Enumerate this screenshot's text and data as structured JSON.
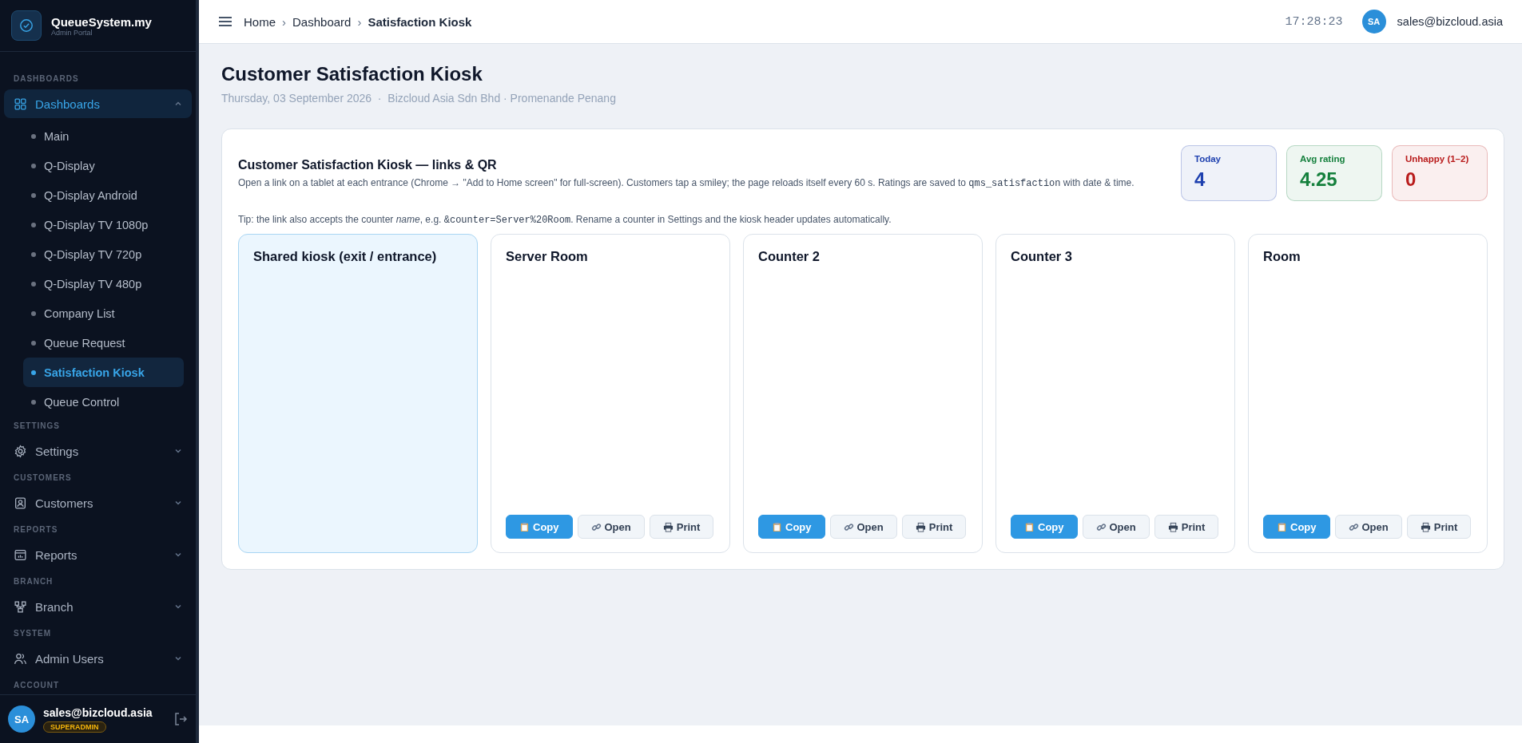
{
  "brand": {
    "name": "QueueSystem.my",
    "subtitle": "Admin Portal"
  },
  "sidebar": {
    "sections": [
      {
        "label": "DASHBOARDS",
        "items": [
          {
            "label": "Dashboards",
            "expanded": true,
            "selected": true,
            "children": [
              {
                "label": "Main",
                "selected": false
              },
              {
                "label": "Q-Display",
                "selected": false
              },
              {
                "label": "Q-Display Android",
                "selected": false
              },
              {
                "label": "Q-Display TV 1080p",
                "selected": false
              },
              {
                "label": "Q-Display TV 720p",
                "selected": false
              },
              {
                "label": "Q-Display TV 480p",
                "selected": false
              },
              {
                "label": "Company List",
                "selected": false
              },
              {
                "label": "Queue Request",
                "selected": false
              },
              {
                "label": "Satisfaction Kiosk",
                "selected": true
              },
              {
                "label": "Queue Control",
                "selected": false
              }
            ]
          }
        ]
      },
      {
        "label": "SETTINGS",
        "items": [
          {
            "label": "Settings",
            "expanded": false,
            "selected": false
          }
        ]
      },
      {
        "label": "CUSTOMERS",
        "items": [
          {
            "label": "Customers",
            "expanded": false,
            "selected": false
          }
        ]
      },
      {
        "label": "REPORTS",
        "items": [
          {
            "label": "Reports",
            "expanded": false,
            "selected": false
          }
        ]
      },
      {
        "label": "BRANCH",
        "items": [
          {
            "label": "Branch",
            "expanded": false,
            "selected": false
          }
        ]
      },
      {
        "label": "SYSTEM",
        "items": [
          {
            "label": "Admin Users",
            "expanded": false,
            "selected": false
          }
        ]
      },
      {
        "label": "ACCOUNT"
      }
    ],
    "user": {
      "initials": "SA",
      "email": "sales@bizcloud.asia",
      "role": "SUPERADMIN"
    }
  },
  "header": {
    "breadcrumbs": [
      {
        "label": "Home",
        "kind": "link"
      },
      {
        "label": "›",
        "kind": "separator"
      },
      {
        "label": "Dashboard",
        "kind": "link"
      },
      {
        "label": "›",
        "kind": "separator"
      },
      {
        "label": "Satisfaction Kiosk",
        "kind": "current"
      }
    ],
    "time": "17:28:23",
    "user": {
      "initials": "SA",
      "email": "sales@bizcloud.asia"
    }
  },
  "page": {
    "title": "Customer Satisfaction Kiosk",
    "subtitle": "Thursday, 03 September 2026  ·  Bizcloud Asia Sdn Bhd · Promenande Penang"
  },
  "panel": {
    "title": "Customer Satisfaction Kiosk — links & QR",
    "description": [
      {
        "text": "Open a link on a tablet at each entrance (Chrome → \"Add to Home screen\" for full-screen). Customers tap a smiley; the page reloads itself every 60 s. Ratings are saved to ",
        "kind": "text"
      },
      {
        "text": "qms_satisfaction",
        "kind": "code"
      },
      {
        "text": " with date & time.",
        "kind": "text"
      }
    ],
    "tip": [
      {
        "text": "Tip: the link also accepts the counter *name*, e.g. ",
        "kind": "text"
      },
      {
        "text": "&counter=Server%20Room",
        "kind": "code"
      },
      {
        "text": ". Rename a counter in Settings and the kiosk header updates automatically.",
        "kind": "text"
      }
    ],
    "stats": [
      {
        "label": "Today",
        "value": "4",
        "color": "#1e40af"
      },
      {
        "label": "Avg rating",
        "value": "4.25",
        "color": "#15803d"
      },
      {
        "label": "Unhappy (1–2)",
        "value": "0",
        "color": "#b91c1c"
      }
    ],
    "kiosks": [
      {
        "title": "Shared kiosk (exit / entrance)",
        "kind": "shared"
      },
      {
        "title": "Server Room",
        "kind": "counter",
        "buttons": [
          {
            "label": "Copy",
            "kind": "primary"
          },
          {
            "label": "Open",
            "kind": "secondary"
          },
          {
            "label": "Print",
            "kind": "secondary"
          }
        ]
      },
      {
        "title": "Counter 2",
        "kind": "counter",
        "buttons": [
          {
            "label": "Copy",
            "kind": "primary"
          },
          {
            "label": "Open",
            "kind": "secondary"
          },
          {
            "label": "Print",
            "kind": "secondary"
          }
        ]
      },
      {
        "title": "Counter 3",
        "kind": "counter",
        "buttons": [
          {
            "label": "Copy",
            "kind": "primary"
          },
          {
            "label": "Open",
            "kind": "secondary"
          },
          {
            "label": "Print",
            "kind": "secondary"
          }
        ]
      },
      {
        "title": "Room",
        "kind": "counter",
        "buttons": [
          {
            "label": "Copy",
            "kind": "primary"
          },
          {
            "label": "Open",
            "kind": "secondary"
          },
          {
            "label": "Print",
            "kind": "secondary"
          }
        ]
      }
    ]
  }
}
